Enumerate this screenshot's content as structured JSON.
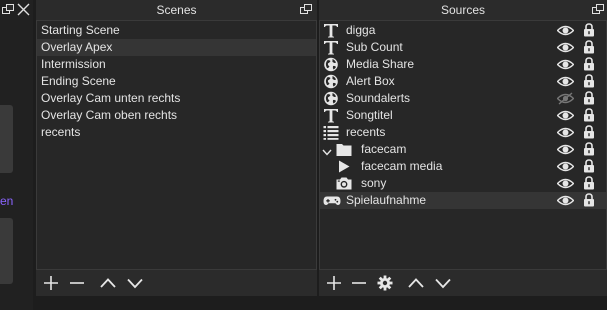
{
  "left": {
    "link_fragment": "en"
  },
  "scenes": {
    "title": "Scenes",
    "items": [
      {
        "label": "Starting Scene",
        "selected": false
      },
      {
        "label": "Overlay Apex",
        "selected": true
      },
      {
        "label": "Intermission",
        "selected": false
      },
      {
        "label": "Ending Scene",
        "selected": false
      },
      {
        "label": "Overlay Cam unten rechts",
        "selected": false
      },
      {
        "label": "Overlay Cam oben rechts",
        "selected": false
      },
      {
        "label": "recents",
        "selected": false
      }
    ],
    "toolbar": [
      "add-icon",
      "remove-icon",
      "move-up-icon",
      "move-down-icon"
    ]
  },
  "sources": {
    "title": "Sources",
    "items": [
      {
        "label": "digga",
        "icon": "text-icon",
        "indent": 0,
        "visible": true,
        "locked": true
      },
      {
        "label": "Sub Count",
        "icon": "text-icon",
        "indent": 0,
        "visible": true,
        "locked": true
      },
      {
        "label": "Media Share",
        "icon": "globe-icon",
        "indent": 0,
        "visible": true,
        "locked": true
      },
      {
        "label": "Alert Box",
        "icon": "globe-icon",
        "indent": 0,
        "visible": true,
        "locked": true
      },
      {
        "label": "Soundalerts",
        "icon": "globe-icon",
        "indent": 0,
        "visible": false,
        "locked": true
      },
      {
        "label": "Songtitel",
        "icon": "text-icon",
        "indent": 0,
        "visible": true,
        "locked": true
      },
      {
        "label": "recents",
        "icon": "list-icon",
        "indent": 0,
        "visible": true,
        "locked": true
      },
      {
        "label": "facecam",
        "icon": "folder-icon",
        "indent": 1,
        "group": true,
        "visible": true,
        "locked": true
      },
      {
        "label": "facecam media",
        "icon": "play-icon",
        "indent": 2,
        "visible": true,
        "locked": true
      },
      {
        "label": "sony",
        "icon": "camera-icon",
        "indent": 2,
        "visible": true,
        "locked": true
      },
      {
        "label": "Spielaufnahme",
        "icon": "gamepad-icon",
        "indent": 0,
        "visible": true,
        "locked": true,
        "selected": true
      }
    ],
    "toolbar": [
      "add-icon",
      "remove-icon",
      "gear-icon",
      "move-up-icon",
      "move-down-icon"
    ]
  },
  "colors": {
    "background": "#1d1d1d",
    "panel": "#272727",
    "header": "#2b2b2b",
    "selected_row": "#353535",
    "text": "#e4e4e4",
    "accent_link": "#8a64ff"
  }
}
